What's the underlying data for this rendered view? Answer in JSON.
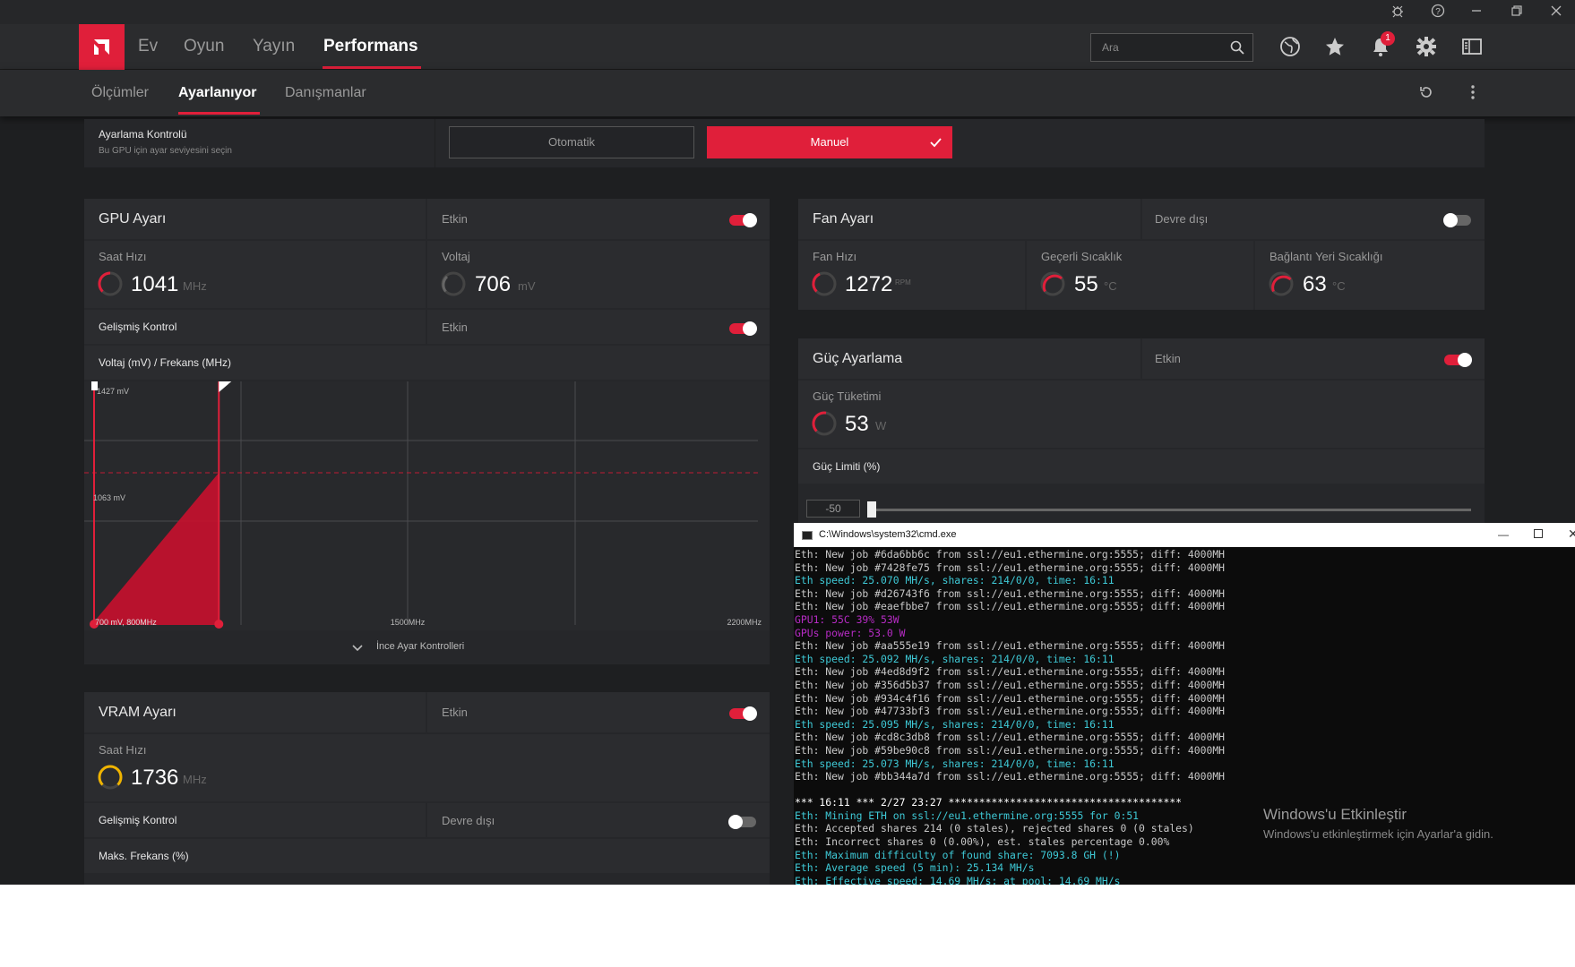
{
  "header": {
    "nav": [
      "Ev",
      "Oyun",
      "Yayın",
      "Performans"
    ],
    "search_placeholder": "Ara",
    "notification_count": "1"
  },
  "subnav": {
    "tabs": [
      "Ölçümler",
      "Ayarlanıyor",
      "Danışmanlar"
    ]
  },
  "tuning_control": {
    "title": "Ayarlama Kontrolü",
    "subtitle": "Bu GPU için ayar seviyesini seçin",
    "auto_label": "Otomatik",
    "manual_label": "Manuel"
  },
  "gpu": {
    "title": "GPU Ayarı",
    "status": "Etkin",
    "clock_label": "Saat Hızı",
    "clock_value": "1041",
    "clock_unit": "MHz",
    "voltage_label": "Voltaj",
    "voltage_value": "706",
    "voltage_unit": "mV",
    "advanced_label": "Gelişmiş Kontrol",
    "advanced_status": "Etkin",
    "curve_title": "Voltaj (mV) / Frekans (MHz)",
    "fine_tune": "İnce Ayar Kontrolleri"
  },
  "chart_data": {
    "type": "area",
    "labels": {
      "top_voltage": "1427 mV",
      "mid_voltage": "1063 mV",
      "start": "700 mV, 800MHz",
      "mid_freq": "1500MHz",
      "max_freq": "2200MHz"
    },
    "x": [
      800,
      1100
    ],
    "y": [
      700,
      1063
    ],
    "xlim": [
      800,
      2200
    ],
    "ylim": [
      700,
      1427
    ],
    "dashed_line_mv": 1063
  },
  "vram": {
    "title": "VRAM Ayarı",
    "status": "Etkin",
    "clock_label": "Saat Hızı",
    "clock_value": "1736",
    "clock_unit": "MHz",
    "advanced_label": "Gelişmiş Kontrol",
    "advanced_status": "Devre dışı",
    "max_freq_label": "Maks. Frekans (%)"
  },
  "fan": {
    "title": "Fan Ayarı",
    "status": "Devre dışı",
    "speed_label": "Fan Hızı",
    "speed_value": "1272",
    "speed_unit": "RPM",
    "temp_label": "Geçerli Sıcaklık",
    "temp_value": "55",
    "temp_unit": "°C",
    "junction_label": "Bağlantı Yeri Sıcaklığı",
    "junction_value": "63",
    "junction_unit": "°C"
  },
  "power": {
    "title": "Güç Ayarlama",
    "status": "Etkin",
    "consumption_label": "Güç Tüketimi",
    "consumption_value": "53",
    "consumption_unit": "W",
    "limit_label": "Güç Limiti (%)",
    "limit_value": "-50"
  },
  "cmd": {
    "title": "C:\\Windows\\system32\\cmd.exe",
    "lines": [
      {
        "t": "Eth: New job #6da6bb6c from ssl://eu1.ethermine.org:5555; diff: 4000MH",
        "c": "#c8c8c8"
      },
      {
        "t": "Eth: New job #7428fe75 from ssl://eu1.ethermine.org:5555; diff: 4000MH",
        "c": "#c8c8c8"
      },
      {
        "t": "Eth speed: 25.070 MH/s, shares: 214/0/0, time: 16:11",
        "c": "#3ec9d6"
      },
      {
        "t": "Eth: New job #d26743f6 from ssl://eu1.ethermine.org:5555; diff: 4000MH",
        "c": "#c8c8c8"
      },
      {
        "t": "Eth: New job #eaefbbe7 from ssl://eu1.ethermine.org:5555; diff: 4000MH",
        "c": "#c8c8c8"
      },
      {
        "t": "GPU1: 55C 39% 53W",
        "c": "#b62bc4"
      },
      {
        "t": "GPUs power: 53.0 W",
        "c": "#b62bc4"
      },
      {
        "t": "Eth: New job #aa555e19 from ssl://eu1.ethermine.org:5555; diff: 4000MH",
        "c": "#c8c8c8"
      },
      {
        "t": "Eth speed: 25.092 MH/s, shares: 214/0/0, time: 16:11",
        "c": "#3ec9d6"
      },
      {
        "t": "Eth: New job #4ed8d9f2 from ssl://eu1.ethermine.org:5555; diff: 4000MH",
        "c": "#c8c8c8"
      },
      {
        "t": "Eth: New job #356d5b37 from ssl://eu1.ethermine.org:5555; diff: 4000MH",
        "c": "#c8c8c8"
      },
      {
        "t": "Eth: New job #934c4f16 from ssl://eu1.ethermine.org:5555; diff: 4000MH",
        "c": "#c8c8c8"
      },
      {
        "t": "Eth: New job #47733bf3 from ssl://eu1.ethermine.org:5555; diff: 4000MH",
        "c": "#c8c8c8"
      },
      {
        "t": "Eth speed: 25.095 MH/s, shares: 214/0/0, time: 16:11",
        "c": "#3ec9d6"
      },
      {
        "t": "Eth: New job #cd8c3db8 from ssl://eu1.ethermine.org:5555; diff: 4000MH",
        "c": "#c8c8c8"
      },
      {
        "t": "Eth: New job #59be90c8 from ssl://eu1.ethermine.org:5555; diff: 4000MH",
        "c": "#c8c8c8"
      },
      {
        "t": "Eth speed: 25.073 MH/s, shares: 214/0/0, time: 16:11",
        "c": "#3ec9d6"
      },
      {
        "t": "Eth: New job #bb344a7d from ssl://eu1.ethermine.org:5555; diff: 4000MH",
        "c": "#c8c8c8"
      },
      {
        "t": "",
        "c": "#c8c8c8"
      },
      {
        "t": "*** 16:11 *** 2/27 23:27 **************************************",
        "c": "#ffffff"
      },
      {
        "t": "Eth: Mining ETH on ssl://eu1.ethermine.org:5555 for 0:51",
        "c": "#3ec9d6"
      },
      {
        "t": "Eth: Accepted shares 214 (0 stales), rejected shares 0 (0 stales)",
        "c": "#c8c8c8"
      },
      {
        "t": "Eth: Incorrect shares 0 (0.00%), est. stales percentage 0.00%",
        "c": "#c8c8c8"
      },
      {
        "t": "Eth: Maximum difficulty of found share: 7093.8 GH (!)",
        "c": "#3ec9d6"
      },
      {
        "t": "Eth: Average speed (5 min): 25.134 MH/s",
        "c": "#3ec9d6"
      },
      {
        "t": "Eth: Effective speed: 14.69 MH/s; at pool: 14.69 MH/s",
        "c": "#3ec9d6"
      }
    ]
  },
  "watermark": {
    "title": "Windows'u Etkinleştir",
    "subtitle": "Windows'u etkinleştirmek için Ayarlar'a gidin."
  },
  "colors": {
    "accent": "#e01f3a",
    "gauge_vram": "#f0b400"
  }
}
